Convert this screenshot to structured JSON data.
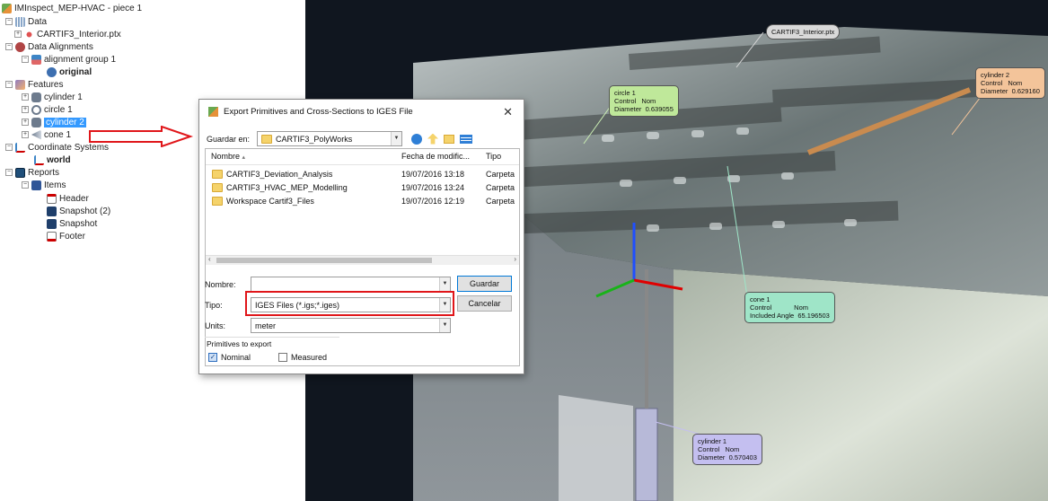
{
  "tree": {
    "root": "IMInspect_MEP-HVAC - piece 1",
    "data": "Data",
    "data_file": "CARTIF3_Interior.ptx",
    "data_alignments": "Data Alignments",
    "alignment_group": "alignment group 1",
    "original": "original",
    "features": "Features",
    "cylinder1": "cylinder 1",
    "circle1": "circle 1",
    "cylinder2": "cylinder 2",
    "cone1": "cone 1",
    "coord_systems": "Coordinate Systems",
    "world": "world",
    "reports": "Reports",
    "items": "Items",
    "header": "Header",
    "snapshot2": "Snapshot (2)",
    "snapshot": "Snapshot",
    "footer": "Footer"
  },
  "dialog": {
    "title": "Export Primitives and Cross-Sections to IGES File",
    "save_in_label": "Guardar en:",
    "save_in_value": "CARTIF3_PolyWorks",
    "col_name": "Nombre",
    "col_date": "Fecha de modific...",
    "col_type": "Tipo",
    "files": [
      {
        "name": "CARTIF3_Deviation_Analysis",
        "date": "19/07/2016 13:18",
        "type": "Carpeta"
      },
      {
        "name": "CARTIF3_HVAC_MEP_Modelling",
        "date": "19/07/2016 13:24",
        "type": "Carpeta"
      },
      {
        "name": "Workspace Cartif3_Files",
        "date": "19/07/2016 12:19",
        "type": "Carpeta"
      }
    ],
    "name_label": "Nombre:",
    "name_value": "",
    "type_label": "Tipo:",
    "type_value": "IGES Files (*.igs;*.iges)",
    "units_label": "Units:",
    "units_value": "meter",
    "save_button": "Guardar",
    "cancel_button": "Cancelar",
    "primitives_label": "Primitives to export",
    "nominal_label": "Nominal",
    "nominal_checked": true,
    "measured_label": "Measured",
    "measured_checked": false
  },
  "viewport": {
    "labels": {
      "ptx": "CARTIF3_Interior.ptx",
      "circle1": "circle 1\nControl   Nom\nDiameter  0.639055",
      "cylinder2": "cylinder 2\nControl   Nom\nDiameter  0.629160",
      "cone1": "cone 1\nControl            Nom\nIncluded Angle  65.196503",
      "cylinder1": "cylinder 1\nControl   Nom\nDiameter  0.570403"
    },
    "colors": {
      "ptx": "#d9d9d9",
      "circle1": "#bfe89a",
      "cylinder2": "#f3c49a",
      "cone1": "#9fe5c8",
      "cylinder1": "#c4bff0"
    }
  }
}
